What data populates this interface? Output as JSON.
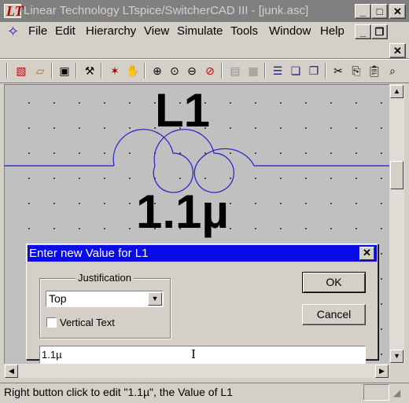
{
  "window": {
    "title": "Linear Technology LTspice/SwitcherCAD III - [junk.asc]",
    "app_icon_text": "LT"
  },
  "menu": {
    "items": [
      "File",
      "Edit",
      "Hierarchy",
      "View",
      "Simulate",
      "Tools",
      "Window",
      "Help"
    ],
    "underlines": [
      "F",
      "E",
      "H",
      "V",
      "S",
      "T",
      "W",
      "H"
    ]
  },
  "toolbar": {
    "icons": [
      "new-schematic-icon",
      "open-icon",
      "save-icon",
      "control-panel-icon",
      "run-icon",
      "halt-icon",
      "zoom-in-icon",
      "zoom-pan-icon",
      "zoom-out-icon",
      "zoom-cancel-icon",
      "autorange-icon",
      "fit-icon",
      "tile-horizontal-icon",
      "cascade-icon",
      "tile-vertical-icon",
      "cut-icon",
      "copy-icon",
      "paste-icon",
      "find-icon"
    ]
  },
  "schematic": {
    "component_name": "L1",
    "component_value": "1.1µ",
    "wire_color": "#1e1ec8"
  },
  "dialog": {
    "title": "Enter new Value for L1",
    "justification_label": "Justification",
    "justification_value": "Top",
    "vertical_text_label": "Vertical Text",
    "vertical_text_checked": false,
    "ok_label": "OK",
    "cancel_label": "Cancel",
    "value_text": "1.1µ"
  },
  "status": {
    "text": "Right button click to edit \"1.1µ\", the Value of L1"
  },
  "colors": {
    "titlebar_inactive": "#808080",
    "dialog_title_active": "#0a0ae6",
    "canvas_bg": "#c0c0c0"
  }
}
